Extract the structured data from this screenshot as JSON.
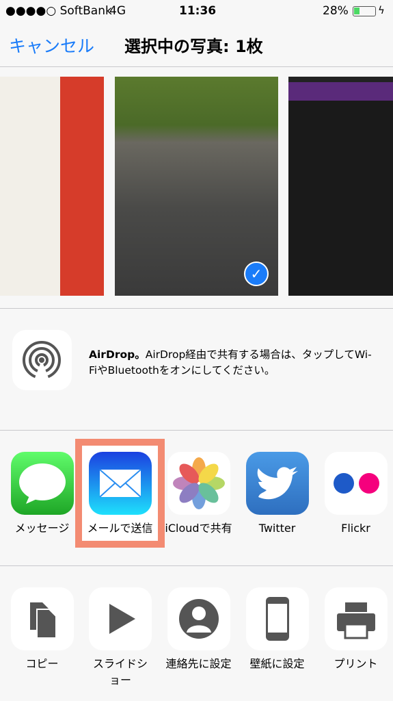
{
  "status": {
    "carrier": "●●●●○ SoftBank",
    "network": "4G",
    "time": "11:36",
    "battery": "28%",
    "battery_level": 0.28
  },
  "nav": {
    "cancel": "キャンセル",
    "title": "選択中の写真: 1枚"
  },
  "airdrop": {
    "title": "AirDrop。",
    "text": "AirDrop経由で共有する場合は、タップしてWi-FiやBluetoothをオンにしてください。"
  },
  "apps": [
    {
      "label": "メッセージ"
    },
    {
      "label": "メールで送信"
    },
    {
      "label": "iCloudで共有"
    },
    {
      "label": "Twitter"
    },
    {
      "label": "Flickr"
    }
  ],
  "actions": [
    {
      "label": "コピー"
    },
    {
      "label": "スライドショー"
    },
    {
      "label": "連絡先に設定"
    },
    {
      "label": "壁紙に設定"
    },
    {
      "label": "プリント"
    }
  ],
  "highlight_color": "#f38b72"
}
